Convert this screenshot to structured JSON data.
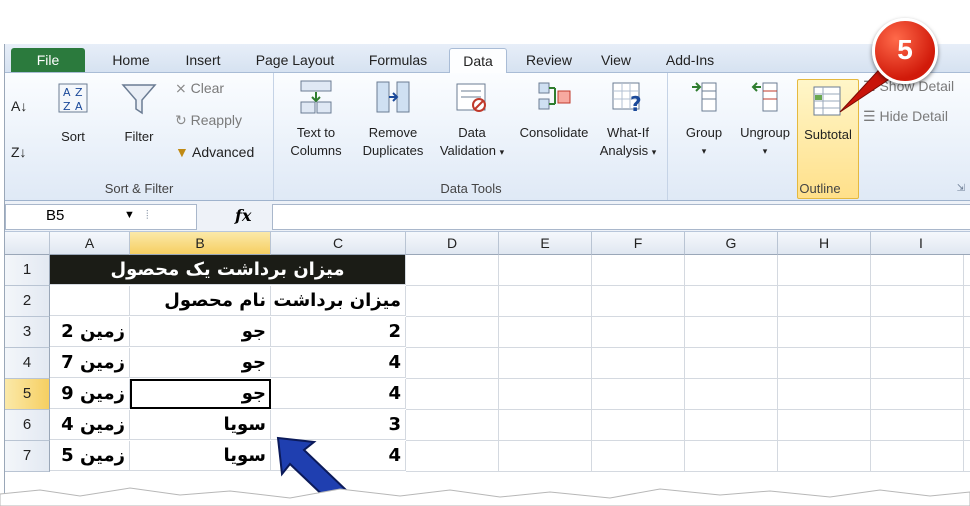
{
  "tabs": [
    "File",
    "Home",
    "Insert",
    "Page Layout",
    "Formulas",
    "Data",
    "Review",
    "View",
    "Add-Ins"
  ],
  "ribbon": {
    "sort_filter": {
      "sort": "Sort",
      "filter": "Filter",
      "clear": "Clear",
      "reapply": "Reapply",
      "advanced": "Advanced",
      "label": "Sort & Filter"
    },
    "data_tools": {
      "text_to_columns_1": "Text to",
      "text_to_columns_2": "Columns",
      "remove_dup_1": "Remove",
      "remove_dup_2": "Duplicates",
      "data_val_1": "Data",
      "data_val_2": "Validation",
      "consolidate": "Consolidate",
      "whatif_1": "What-If",
      "whatif_2": "Analysis",
      "label": "Data Tools"
    },
    "outline": {
      "group": "Group",
      "ungroup": "Ungroup",
      "subtotal": "Subtotal",
      "show_detail": "Show Detail",
      "hide_detail": "Hide Detail",
      "label": "Outline"
    }
  },
  "namebox": "B5",
  "fx": "fx",
  "columns": [
    "A",
    "B",
    "C",
    "D",
    "E",
    "F",
    "G",
    "H",
    "I"
  ],
  "rows": [
    {
      "n": "1",
      "title": "میزان برداشت یک محصول"
    },
    {
      "n": "2",
      "a": "",
      "b": "نام محصول",
      "c": "میزان برداشت"
    },
    {
      "n": "3",
      "a": "زمین 2",
      "b": "جو",
      "c": "2"
    },
    {
      "n": "4",
      "a": "زمین 7",
      "b": "جو",
      "c": "4"
    },
    {
      "n": "5",
      "a": "زمین 9",
      "b": "جو",
      "c": "4"
    },
    {
      "n": "6",
      "a": "زمین 4",
      "b": "سویا",
      "c": "3"
    },
    {
      "n": "7",
      "a": "زمین 5",
      "b": "سویا",
      "c": "4"
    }
  ],
  "step_badge": "5",
  "colors": {
    "file_tab": "#2b7a3d",
    "badge": "#d11a0a",
    "arrow": "#1f3fb0",
    "selection": "#f6cf62"
  }
}
